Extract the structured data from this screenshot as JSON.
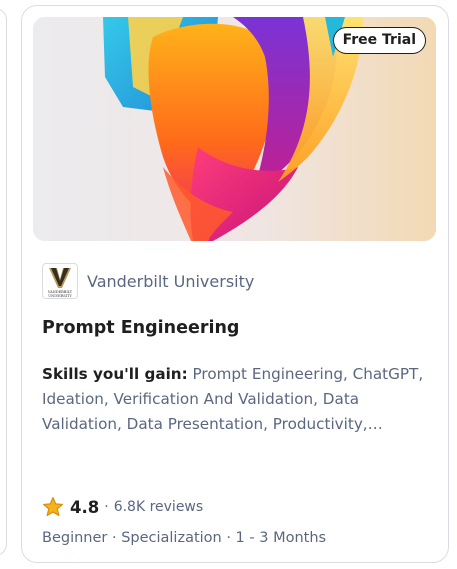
{
  "card": {
    "badge": "Free Trial",
    "partner": "Vanderbilt University",
    "partner_logo_text": "VANDERBILT UNIVERSITY",
    "title": "Prompt Engineering",
    "skills_label": "Skills you'll gain:",
    "skills_text": " Prompt Engineering, ChatGPT, Ideation, Verification And Validation, Data Validation, Data Presentation, Productivity,…",
    "rating": "4.8",
    "separator": "·",
    "reviews": "6.8K reviews",
    "meta": "Beginner · Specialization · 1 - 3 Months"
  },
  "icons": {
    "star": "star-icon",
    "logo": "vanderbilt-logo"
  },
  "colors": {
    "star_fill": "#f5b120",
    "star_stroke": "#d98f00",
    "muted_text": "#5b6780",
    "dark_text": "#1f1f1f",
    "card_border": "#d9dde3",
    "logo_gold": "#b39b5c"
  }
}
